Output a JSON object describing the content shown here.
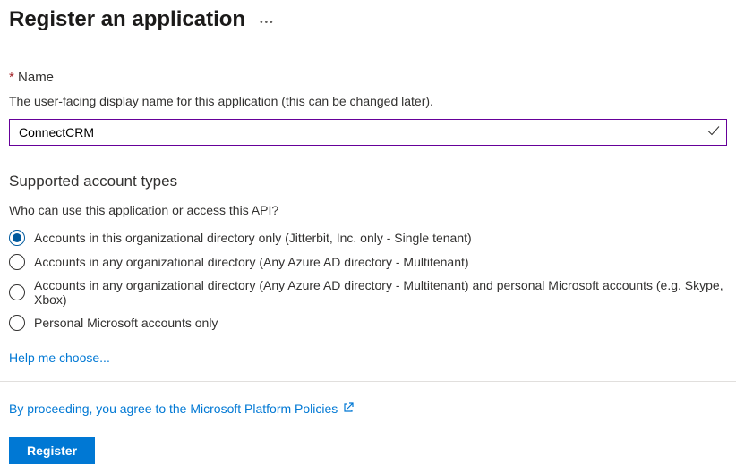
{
  "header": {
    "title": "Register an application"
  },
  "nameField": {
    "label": "Name",
    "description": "The user-facing display name for this application (this can be changed later).",
    "value": "ConnectCRM"
  },
  "accountTypes": {
    "title": "Supported account types",
    "subtitle": "Who can use this application or access this API?",
    "options": [
      "Accounts in this organizational directory only (Jitterbit, Inc. only - Single tenant)",
      "Accounts in any organizational directory (Any Azure AD directory - Multitenant)",
      "Accounts in any organizational directory (Any Azure AD directory - Multitenant) and personal Microsoft accounts (e.g. Skype, Xbox)",
      "Personal Microsoft accounts only"
    ],
    "selectedIndex": 0,
    "helpLink": "Help me choose..."
  },
  "policy": {
    "text": "By proceeding, you agree to the Microsoft Platform Policies"
  },
  "actions": {
    "register": "Register"
  }
}
